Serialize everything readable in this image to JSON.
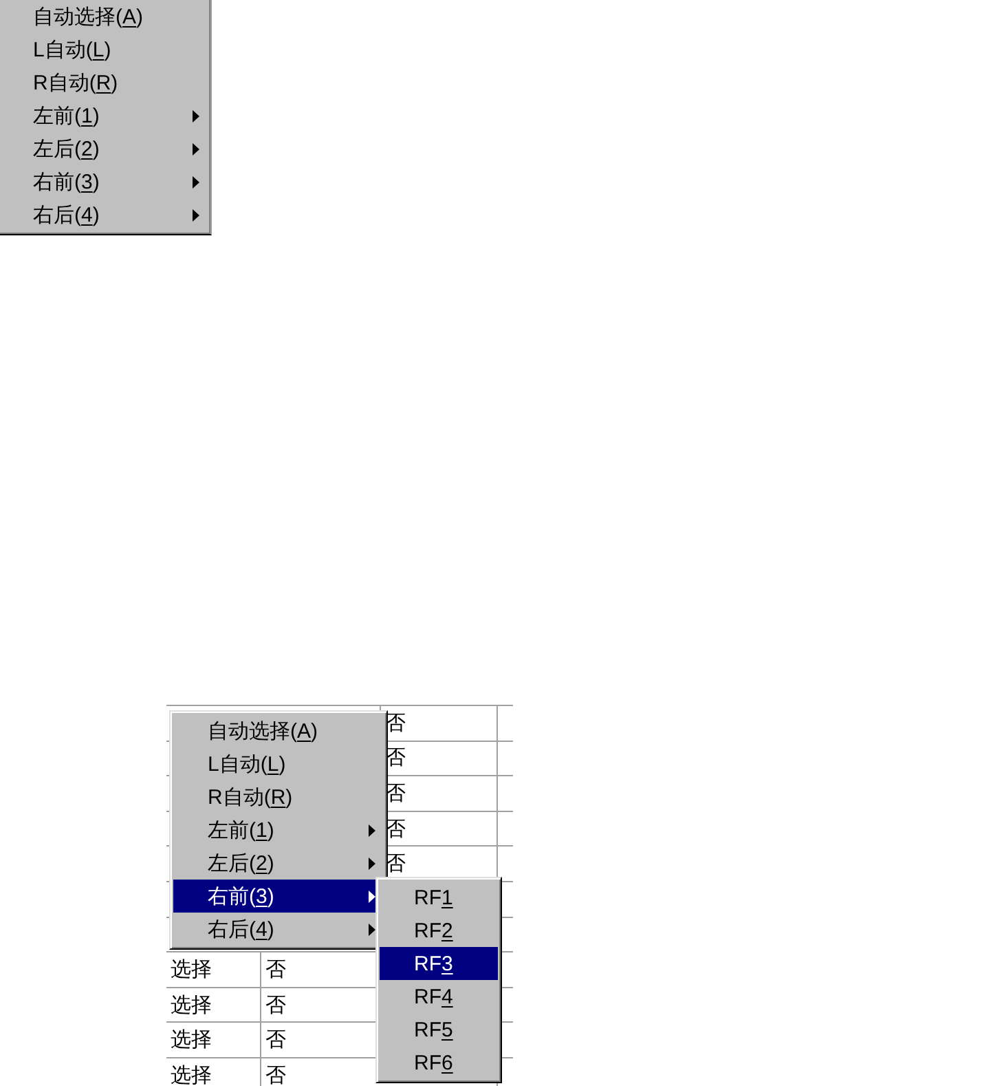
{
  "popup_menu": {
    "items": [
      {
        "label": "自动选择(",
        "access_key": "A",
        "label_end": ")",
        "has_submenu": false,
        "selected": false
      },
      {
        "label": "L自动(",
        "access_key": "L",
        "label_end": ")",
        "has_submenu": false,
        "selected": false
      },
      {
        "label": "R自动(",
        "access_key": "R",
        "label_end": ")",
        "has_submenu": false,
        "selected": false
      },
      {
        "label": "左前(",
        "access_key": "1",
        "label_end": ")",
        "has_submenu": true,
        "selected": false
      },
      {
        "label": "左后(",
        "access_key": "2",
        "label_end": ")",
        "has_submenu": true,
        "selected": false
      },
      {
        "label": "右前(",
        "access_key": "3",
        "label_end": ")",
        "has_submenu": true,
        "selected": false
      },
      {
        "label": "右后(",
        "access_key": "4",
        "label_end": ")",
        "has_submenu": true,
        "selected": false
      }
    ]
  },
  "table": {
    "rows_beside_menu": [
      {
        "column_2": "否"
      },
      {
        "column_2": "否"
      },
      {
        "column_2": "否"
      },
      {
        "column_2": "否"
      },
      {
        "column_2": "否"
      }
    ],
    "rows_below_menu": [
      {
        "column_1": "选择",
        "column_2": "否"
      },
      {
        "column_1": "选择",
        "column_2": "否"
      },
      {
        "column_1": "选择",
        "column_2": "否"
      },
      {
        "column_1": "选择",
        "column_2": "否"
      }
    ]
  },
  "context_menu": {
    "items": [
      {
        "label": "自动选择(",
        "access_key": "A",
        "label_end": ")",
        "has_submenu": false,
        "selected": false
      },
      {
        "label": "L自动(",
        "access_key": "L",
        "label_end": ")",
        "has_submenu": false,
        "selected": false
      },
      {
        "label": "R自动(",
        "access_key": "R",
        "label_end": ")",
        "has_submenu": false,
        "selected": false
      },
      {
        "label": "左前(",
        "access_key": "1",
        "label_end": ")",
        "has_submenu": true,
        "selected": false
      },
      {
        "label": "左后(",
        "access_key": "2",
        "label_end": ")",
        "has_submenu": true,
        "selected": false
      },
      {
        "label": "右前(",
        "access_key": "3",
        "label_end": ")",
        "has_submenu": true,
        "selected": true
      },
      {
        "label": "右后(",
        "access_key": "4",
        "label_end": ")",
        "has_submenu": true,
        "selected": false
      }
    ]
  },
  "submenu": {
    "items": [
      {
        "label": "RF",
        "access_key": "1",
        "selected": false
      },
      {
        "label": "RF",
        "access_key": "2",
        "selected": false
      },
      {
        "label": "RF",
        "access_key": "3",
        "selected": true
      },
      {
        "label": "RF",
        "access_key": "4",
        "selected": false
      },
      {
        "label": "RF",
        "access_key": "5",
        "selected": false
      },
      {
        "label": "RF",
        "access_key": "6",
        "selected": false
      }
    ]
  }
}
